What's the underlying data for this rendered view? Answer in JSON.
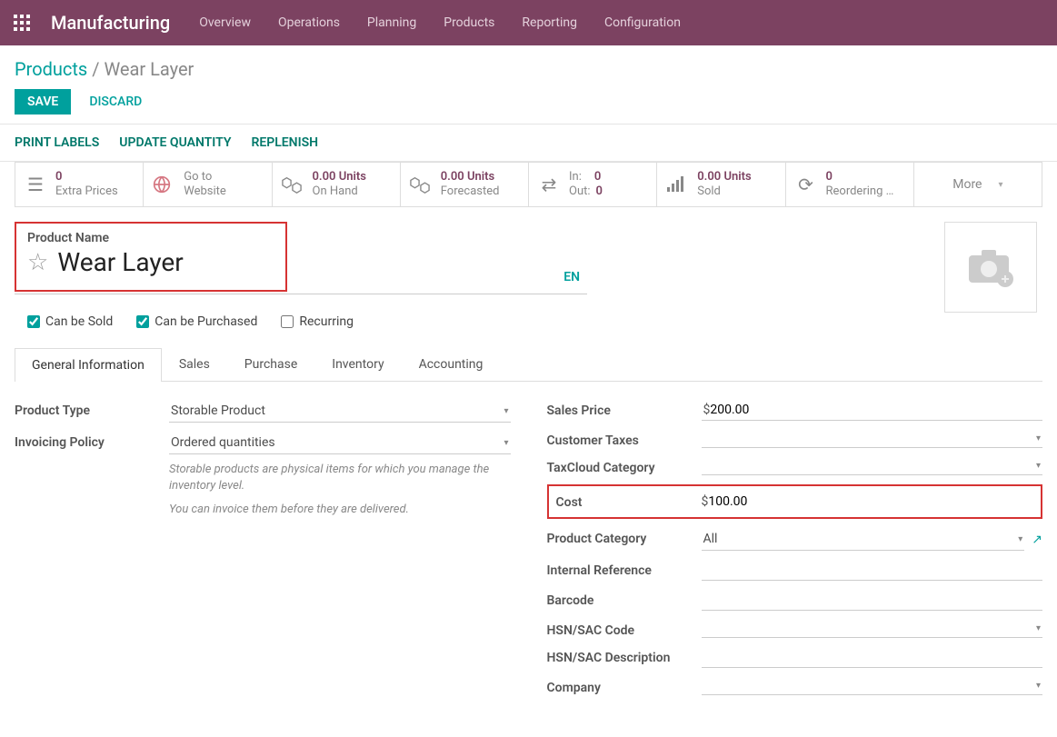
{
  "nav": {
    "title": "Manufacturing",
    "links": [
      "Overview",
      "Operations",
      "Planning",
      "Products",
      "Reporting",
      "Configuration"
    ]
  },
  "breadcrumb": {
    "parent": "Products",
    "current": "Wear Layer"
  },
  "buttons": {
    "save": "SAVE",
    "discard": "DISCARD"
  },
  "actions": {
    "print_labels": "PRINT LABELS",
    "update_quantity": "UPDATE QUANTITY",
    "replenish": "REPLENISH"
  },
  "stats": {
    "extra_prices": {
      "value": "0",
      "label": "Extra Prices"
    },
    "website": {
      "line1": "Go to",
      "line2": "Website"
    },
    "on_hand": {
      "value": "0.00 Units",
      "label": "On Hand"
    },
    "forecasted": {
      "value": "0.00 Units",
      "label": "Forecasted"
    },
    "in_out": {
      "in_label": "In:",
      "in_val": "0",
      "out_label": "Out:",
      "out_val": "0"
    },
    "sold": {
      "value": "0.00 Units",
      "label": "Sold"
    },
    "reordering": {
      "value": "0",
      "label": "Reordering …"
    },
    "more": "More"
  },
  "product": {
    "name_label": "Product Name",
    "name": "Wear Layer",
    "lang": "EN",
    "can_be_sold": "Can be Sold",
    "can_be_purchased": "Can be Purchased",
    "recurring": "Recurring"
  },
  "tabs": [
    "General Information",
    "Sales",
    "Purchase",
    "Inventory",
    "Accounting"
  ],
  "left": {
    "product_type": {
      "label": "Product Type",
      "value": "Storable Product"
    },
    "invoicing_policy": {
      "label": "Invoicing Policy",
      "value": "Ordered quantities"
    },
    "hint1": "Storable products are physical items for which you manage the inventory level.",
    "hint2": "You can invoice them before they are delivered."
  },
  "right": {
    "sales_price": {
      "label": "Sales Price",
      "currency": "$",
      "value": "200.00"
    },
    "customer_taxes": {
      "label": "Customer Taxes"
    },
    "taxcloud": {
      "label": "TaxCloud Category"
    },
    "cost": {
      "label": "Cost",
      "currency": "$",
      "value": "100.00"
    },
    "product_category": {
      "label": "Product Category",
      "value": "All"
    },
    "internal_reference": {
      "label": "Internal Reference"
    },
    "barcode": {
      "label": "Barcode"
    },
    "hsn_code": {
      "label": "HSN/SAC Code"
    },
    "hsn_desc": {
      "label": "HSN/SAC Description"
    },
    "company": {
      "label": "Company"
    }
  }
}
